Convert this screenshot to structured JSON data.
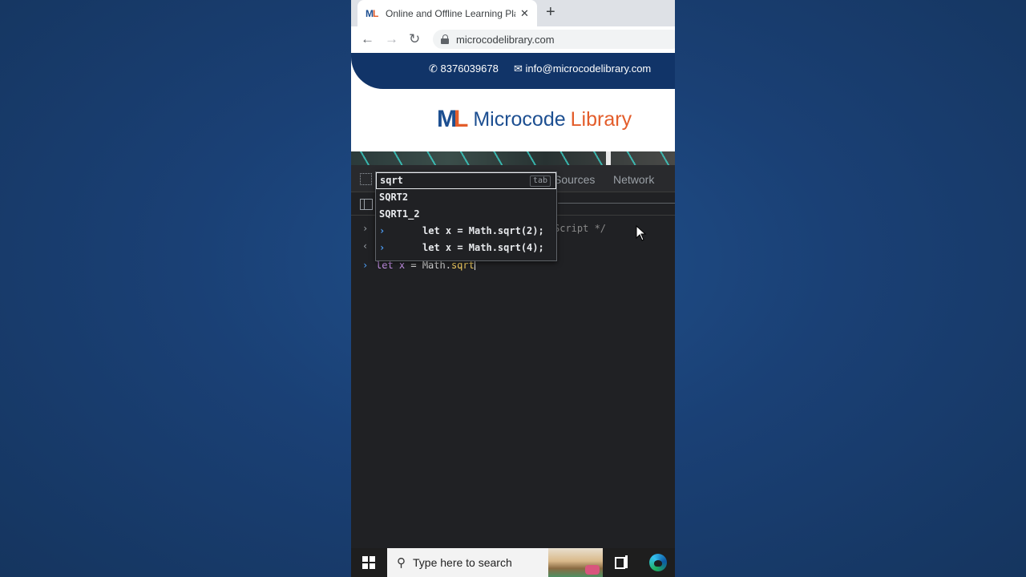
{
  "browser": {
    "tab_title": "Online and Offline Learning Platf",
    "url": "microcodelibrary.com"
  },
  "site": {
    "phone": "8376039678",
    "email": "info@microcodelibrary.com",
    "logo_mark_a": "M",
    "logo_mark_b": "L",
    "logo_text_a": "Microcode",
    "logo_text_b": "Library"
  },
  "devtools": {
    "tabs": [
      "Sources",
      "Network"
    ],
    "console_line1_fragment": "Script */",
    "input": {
      "let": "let",
      "var": "x",
      "eq": " = Math.",
      "fn": "sqrt"
    },
    "autocomplete": {
      "items": [
        "sqrt",
        "SQRT2",
        "SQRT1_2"
      ],
      "hint": "tab",
      "history": [
        "let x = Math.sqrt(2);",
        "let x = Math.sqrt(4);"
      ]
    }
  },
  "taskbar": {
    "search_placeholder": "Type here to search"
  },
  "colors": {
    "brand_blue": "#1d4f91",
    "brand_orange": "#e35d2b",
    "contact_bar": "#113468",
    "devtools_bg": "#202124"
  }
}
